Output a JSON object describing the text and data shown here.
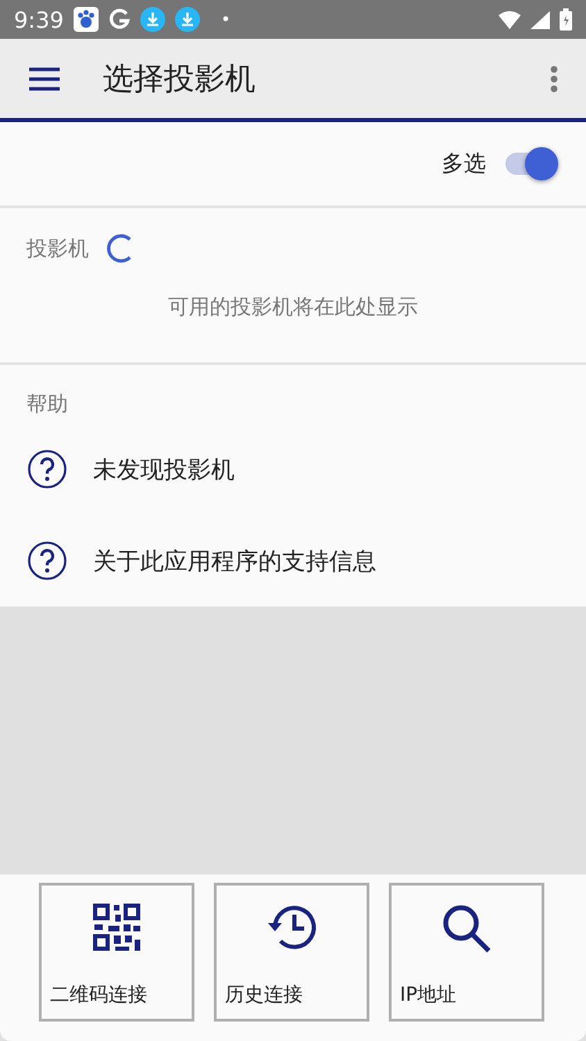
{
  "status_bar": {
    "time": "9:39",
    "dot": "•"
  },
  "app_bar": {
    "title": "选择投影机"
  },
  "multi_select": {
    "label": "多选",
    "on": true
  },
  "projectors": {
    "heading": "投影机",
    "loading": true,
    "empty_text": "可用的投影机将在此处显示"
  },
  "help": {
    "heading": "帮助",
    "items": [
      {
        "label": "未发现投影机"
      },
      {
        "label": "关于此应用程序的支持信息"
      }
    ]
  },
  "bottom_buttons": [
    {
      "kind": "qr",
      "label": "二维码连接"
    },
    {
      "kind": "history",
      "label": "历史连接"
    },
    {
      "kind": "search",
      "label": "IP地址"
    }
  ]
}
